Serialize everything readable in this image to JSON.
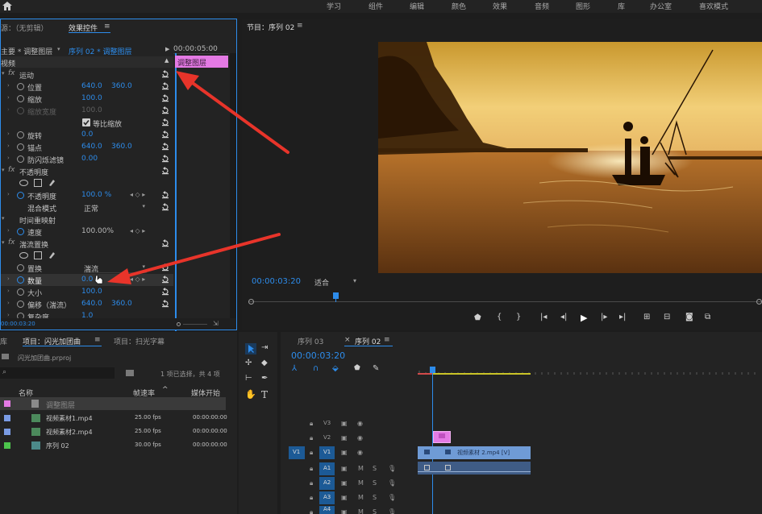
{
  "topbar": {
    "workspaces": [
      "学习",
      "组件",
      "编辑",
      "颜色",
      "效果",
      "音频",
      "图形",
      "库",
      "办公室",
      "喜欢模式"
    ]
  },
  "fx_panel": {
    "source_tab": "源：（无剪辑）",
    "active_tab": "效果控件",
    "menu_icon": "≡",
    "master": "主要 * 调整图层",
    "sequence_clip": "序列 02 * 调整图层",
    "timecode_ruler": "00:00:05:00",
    "clip_label": "调整图层",
    "video_header": "视频",
    "motion": "运动",
    "position": {
      "label": "位置",
      "x": "640.0",
      "y": "360.0"
    },
    "scale": {
      "label": "缩放",
      "value": "100.0"
    },
    "scale_width": {
      "label": "缩放宽度",
      "value": "100.0"
    },
    "uniform_scale": "等比缩放",
    "rotation": {
      "label": "旋转",
      "value": "0.0"
    },
    "anchor": {
      "label": "锚点",
      "x": "640.0",
      "y": "360.0"
    },
    "antiflicker": {
      "label": "防闪烁滤镜",
      "value": "0.00"
    },
    "opacity": "不透明度",
    "opacity_prop": {
      "label": "不透明度",
      "value": "100.0 %"
    },
    "blend": {
      "label": "混合模式",
      "value": "正常"
    },
    "time_remap": "时间重映射",
    "speed": {
      "label": "速度",
      "value": "100.00%"
    },
    "turbulent": "湍流置换",
    "displace": {
      "label": "置换",
      "value": "湍流"
    },
    "amount": {
      "label": "数量",
      "value": "0.0"
    },
    "size": {
      "label": "大小",
      "value": "100.0"
    },
    "offset": {
      "label": "偏移（湍流）",
      "x": "640.0",
      "y": "360.0"
    },
    "complexity": {
      "label": "复杂度",
      "value": "1.0"
    },
    "timecode": "00:00:03:20"
  },
  "program": {
    "title": "节目：序列 02",
    "menu_icon": "≡",
    "timecode": "00:00:03:20",
    "fit": "适合"
  },
  "project": {
    "tab1": "库",
    "tab2": "项目：闪光加团曲",
    "tab3": "项目：扫光字幕",
    "file": "闪光加团曲.prproj",
    "selection": "1 项已选择，共 4 项",
    "col_name": "名称",
    "col_rate": "帧速率",
    "col_start": "媒体开始",
    "items": [
      {
        "name": "调整图层",
        "rate": "",
        "start": "",
        "color": "#e47ae4"
      },
      {
        "name": "视频素材1.mp4",
        "rate": "25.00 fps",
        "start": "00:00:00:00",
        "color": "#7a9be4"
      },
      {
        "name": "视频素材2.mp4",
        "rate": "25.00 fps",
        "start": "00:00:00:00",
        "color": "#7a9be4"
      },
      {
        "name": "序列 02",
        "rate": "30.00 fps",
        "start": "00:00:00:00",
        "color": "#4cc44c"
      }
    ]
  },
  "timeline": {
    "tab1": "序列 03",
    "tab2": "序列 02",
    "menu_icon": "≡",
    "close": "×",
    "timecode": "00:00:03:20",
    "tracks": [
      "V3",
      "V2",
      "V1",
      "A1",
      "A2",
      "A3",
      "A4"
    ],
    "src_v1": "V1",
    "clip_label": "视频素材 2.mp4 [V]",
    "m": "M",
    "s": "S"
  },
  "colors": {
    "accent": "#2d8ceb",
    "clip_pink": "#e47ae4",
    "clip_blue": "#6f9bd6"
  }
}
